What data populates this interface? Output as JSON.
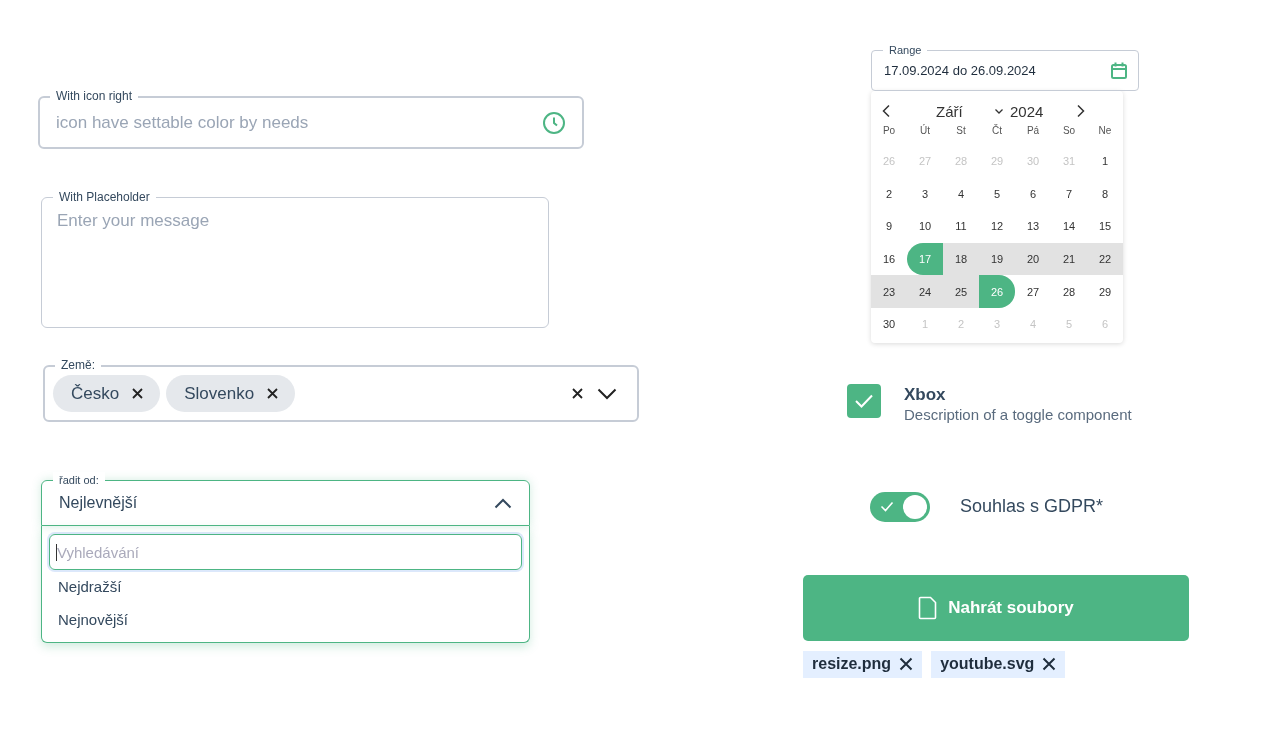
{
  "icon_field": {
    "label": "With icon right",
    "placeholder": "icon have settable color by needs"
  },
  "textarea": {
    "label": "With Placeholder",
    "placeholder": "Enter your message"
  },
  "countries": {
    "label": "Země:",
    "tags": [
      "Česko",
      "Slovenko"
    ]
  },
  "sort": {
    "label": "řadit od:",
    "value": "Nejlevnější",
    "expanded": true,
    "search_placeholder": "Vyhledávání",
    "options": [
      "Nejdražší",
      "Nejnovější"
    ]
  },
  "range": {
    "label": "Range",
    "value": "17.09.2024 do 26.09.2024"
  },
  "calendar": {
    "month": "Září",
    "year": "2024",
    "weekdays": [
      "Po",
      "Út",
      "St",
      "Čt",
      "Pá",
      "So",
      "Ne"
    ],
    "weeks": [
      [
        {
          "day": "26",
          "kind": "other"
        },
        {
          "day": "27",
          "kind": "other"
        },
        {
          "day": "28",
          "kind": "other"
        },
        {
          "day": "29",
          "kind": "other"
        },
        {
          "day": "30",
          "kind": "other"
        },
        {
          "day": "31",
          "kind": "other"
        },
        {
          "day": "1",
          "kind": "normal"
        }
      ],
      [
        {
          "day": "2",
          "kind": "normal"
        },
        {
          "day": "3",
          "kind": "normal"
        },
        {
          "day": "4",
          "kind": "normal"
        },
        {
          "day": "5",
          "kind": "normal"
        },
        {
          "day": "6",
          "kind": "normal"
        },
        {
          "day": "7",
          "kind": "normal"
        },
        {
          "day": "8",
          "kind": "normal"
        }
      ],
      [
        {
          "day": "9",
          "kind": "normal"
        },
        {
          "day": "10",
          "kind": "normal"
        },
        {
          "day": "11",
          "kind": "normal"
        },
        {
          "day": "12",
          "kind": "normal"
        },
        {
          "day": "13",
          "kind": "normal"
        },
        {
          "day": "14",
          "kind": "normal"
        },
        {
          "day": "15",
          "kind": "normal"
        }
      ],
      [
        {
          "day": "16",
          "kind": "normal"
        },
        {
          "day": "17",
          "kind": "start"
        },
        {
          "day": "18",
          "kind": "range"
        },
        {
          "day": "19",
          "kind": "range"
        },
        {
          "day": "20",
          "kind": "range"
        },
        {
          "day": "21",
          "kind": "range"
        },
        {
          "day": "22",
          "kind": "range"
        }
      ],
      [
        {
          "day": "23",
          "kind": "range"
        },
        {
          "day": "24",
          "kind": "range"
        },
        {
          "day": "25",
          "kind": "range"
        },
        {
          "day": "26",
          "kind": "end"
        },
        {
          "day": "27",
          "kind": "normal"
        },
        {
          "day": "28",
          "kind": "normal"
        },
        {
          "day": "29",
          "kind": "normal"
        }
      ],
      [
        {
          "day": "30",
          "kind": "normal"
        },
        {
          "day": "1",
          "kind": "other"
        },
        {
          "day": "2",
          "kind": "other"
        },
        {
          "day": "3",
          "kind": "other"
        },
        {
          "day": "4",
          "kind": "other"
        },
        {
          "day": "5",
          "kind": "other"
        },
        {
          "day": "6",
          "kind": "other"
        }
      ]
    ]
  },
  "checkbox": {
    "title": "Xbox",
    "description": "Description of a toggle component",
    "checked": true
  },
  "toggle": {
    "label": "Souhlas s GDPR*",
    "on": true
  },
  "upload": {
    "label": "Nahrát soubory",
    "files": [
      "resize.png",
      "youtube.svg"
    ]
  }
}
